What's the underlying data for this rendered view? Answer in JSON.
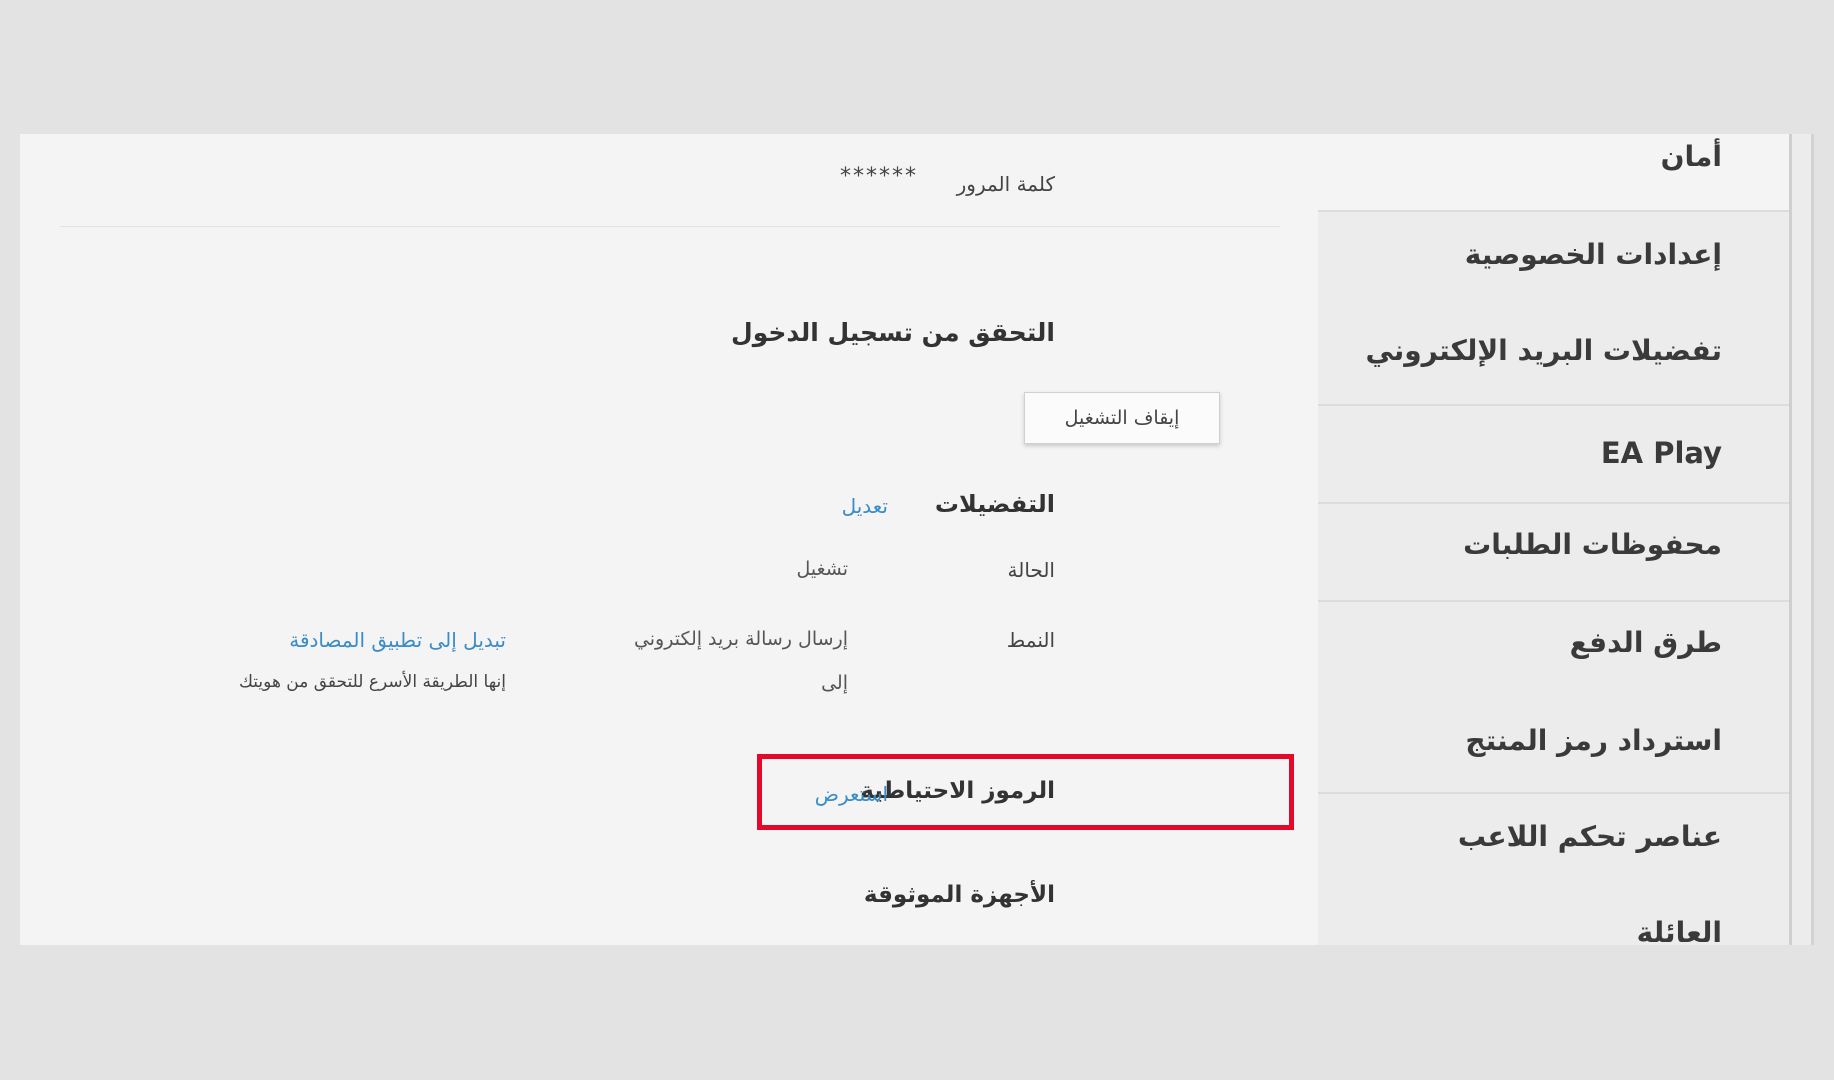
{
  "sidebar": {
    "items": [
      {
        "label": "أمان",
        "active": true
      },
      {
        "label": "إعدادات الخصوصية"
      },
      {
        "label": "تفضيلات البريد الإلكتروني"
      },
      {
        "label": "EA Play"
      },
      {
        "label": "محفوظات الطلبات"
      },
      {
        "label": "طرق الدفع"
      },
      {
        "label": "استرداد رمز المنتج"
      },
      {
        "label": "عناصر تحكم اللاعب"
      },
      {
        "label": "العائلة"
      }
    ]
  },
  "password": {
    "label": "كلمة المرور",
    "value": "******"
  },
  "login_verification": {
    "title": "التحقق من تسجيل الدخول",
    "button_label": "إيقاف التشغيل",
    "preferences_label": "التفضيلات",
    "edit_link": "تعديل",
    "status_label": "الحالة",
    "status_value": "تشغيل",
    "mode_label": "النمط",
    "mode_value_line1": "إرسال رسالة بريد إلكتروني",
    "mode_value_line2": "إلى",
    "switch_link": "تبديل إلى تطبيق المصادقة",
    "switch_hint": "إنها الطريقة الأسرع للتحقق من هويتك"
  },
  "backup_codes": {
    "label": "الرموز الاحتياطية",
    "view_link": "استعرض"
  },
  "trusted_devices": {
    "label": "الأجهزة الموثوقة"
  },
  "colors": {
    "link": "#3a8cc8",
    "highlight": "#e4092a"
  }
}
